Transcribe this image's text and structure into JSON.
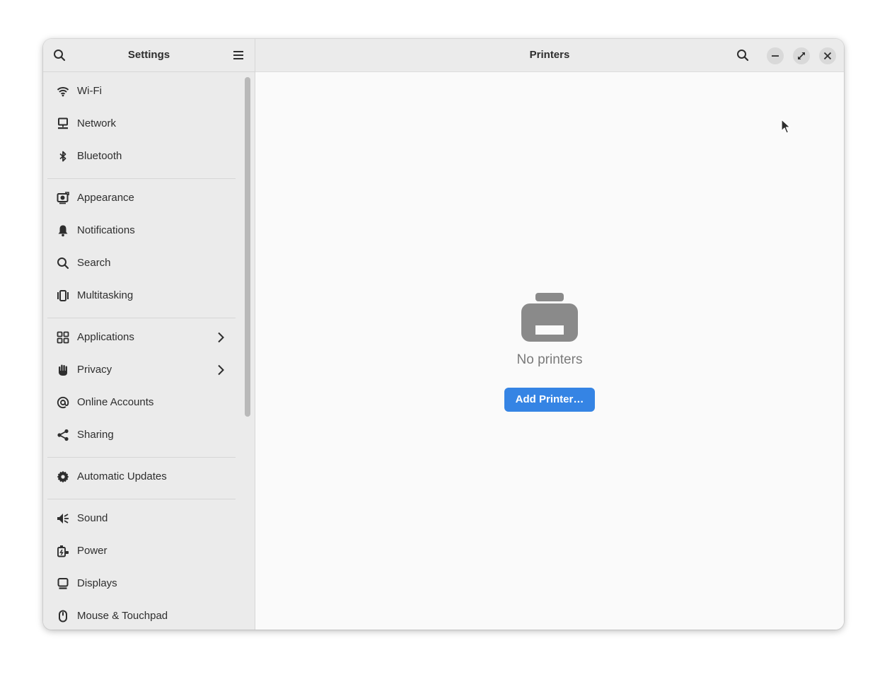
{
  "sidebar": {
    "title": "Settings",
    "search_icon": "search-icon",
    "menu_icon": "hamburger-menu-icon",
    "items": [
      {
        "label": "Wi-Fi",
        "icon": "wifi-icon"
      },
      {
        "label": "Network",
        "icon": "network-icon"
      },
      {
        "label": "Bluetooth",
        "icon": "bluetooth-icon"
      },
      {
        "label": "Appearance",
        "icon": "appearance-icon"
      },
      {
        "label": "Notifications",
        "icon": "bell-icon"
      },
      {
        "label": "Search",
        "icon": "search-icon"
      },
      {
        "label": "Multitasking",
        "icon": "multitasking-icon"
      },
      {
        "label": "Applications",
        "icon": "grid-icon",
        "has_submenu": true
      },
      {
        "label": "Privacy",
        "icon": "hand-icon",
        "has_submenu": true
      },
      {
        "label": "Online Accounts",
        "icon": "at-icon"
      },
      {
        "label": "Sharing",
        "icon": "share-icon"
      },
      {
        "label": "Automatic Updates",
        "icon": "gear-icon"
      },
      {
        "label": "Sound",
        "icon": "speaker-icon"
      },
      {
        "label": "Power",
        "icon": "power-icon"
      },
      {
        "label": "Displays",
        "icon": "display-icon"
      },
      {
        "label": "Mouse & Touchpad",
        "icon": "mouse-icon"
      }
    ]
  },
  "main": {
    "title": "Printers",
    "empty_state": {
      "icon": "printer-icon",
      "text": "No printers",
      "button_label": "Add Printer…"
    }
  },
  "window_controls": {
    "search": "search-icon",
    "minimize": "minimize-icon",
    "maximize": "maximize-icon",
    "close": "close-icon"
  },
  "colors": {
    "accent": "#3584e4",
    "sidebar_bg": "#ebebeb",
    "content_bg": "#fafafa",
    "icon": "#2e2e2e",
    "empty_icon": "#8a8a8a"
  }
}
